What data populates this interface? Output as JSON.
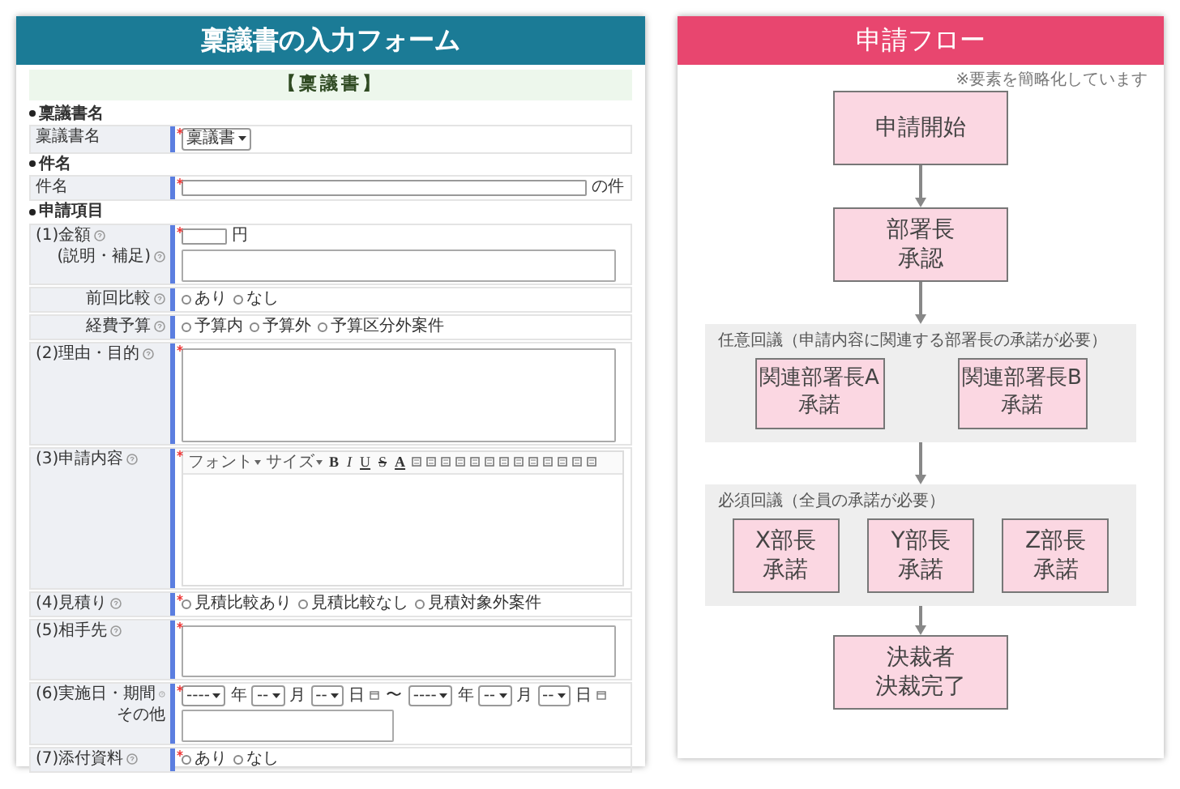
{
  "form_panel": {
    "title": "稟議書の入力フォーム",
    "heading": "【稟議書】",
    "sections": [
      {
        "title": "稟議書名",
        "rows": [
          {
            "kind": "select",
            "label": "稟議書名",
            "help": false,
            "required": true,
            "value": "稟議書"
          }
        ]
      },
      {
        "title": "件名",
        "rows": [
          {
            "kind": "text",
            "label": "件名",
            "help": false,
            "required": true,
            "suffix": "の件"
          }
        ]
      },
      {
        "title": "申請項目",
        "rows": [
          {
            "kind": "amount",
            "label": "(1)金額",
            "sub": false,
            "help": true,
            "required": true,
            "suffix": "円",
            "note_label": "(説明・補足)",
            "note_help": true
          },
          {
            "kind": "radio",
            "label": "前回比較",
            "sub": true,
            "help": true,
            "required": false,
            "options": [
              {
                "label": "あり",
                "selected": false
              },
              {
                "label": "なし",
                "selected": false
              }
            ]
          },
          {
            "kind": "radio",
            "label": "経費予算",
            "sub": true,
            "help": true,
            "required": false,
            "options": [
              {
                "label": "予算内",
                "selected": false
              },
              {
                "label": "予算外",
                "selected": false
              },
              {
                "label": "予算区分外案件",
                "selected": false
              }
            ]
          },
          {
            "kind": "long_text",
            "label": "(2)理由・目的",
            "sub": false,
            "help": true,
            "required": true
          },
          {
            "kind": "rich_text",
            "label": "(3)申請内容",
            "sub": false,
            "help": true,
            "required": true,
            "toolbar": [
              {
                "kind": "select",
                "label": "フォント"
              },
              {
                "kind": "select",
                "label": "サイズ"
              },
              {
                "kind": "glyph",
                "label": "B"
              },
              {
                "kind": "glyph",
                "label": "I"
              },
              {
                "kind": "glyph",
                "label": "U"
              },
              {
                "kind": "glyph",
                "label": "S"
              },
              {
                "kind": "glyph",
                "label": "A"
              },
              {
                "kind": "icon"
              },
              {
                "kind": "icon"
              },
              {
                "kind": "icon"
              },
              {
                "kind": "icon"
              },
              {
                "kind": "icon"
              },
              {
                "kind": "icon"
              },
              {
                "kind": "icon"
              },
              {
                "kind": "icon"
              },
              {
                "kind": "icon"
              },
              {
                "kind": "icon"
              },
              {
                "kind": "icon"
              },
              {
                "kind": "icon"
              },
              {
                "kind": "icon"
              }
            ]
          },
          {
            "kind": "radio",
            "label": "(4)見積り",
            "sub": false,
            "help": true,
            "required": true,
            "options": [
              {
                "label": "見積比較あり",
                "selected": false
              },
              {
                "label": "見積比較なし",
                "selected": false
              },
              {
                "label": "見積対象外案件",
                "selected": false
              }
            ]
          },
          {
            "kind": "text_area",
            "label": "(5)相手先",
            "sub": false,
            "help": true,
            "required": true
          },
          {
            "kind": "period",
            "label": "(6)実施日・期間",
            "sub": false,
            "help": true,
            "required": true,
            "start": {
              "year_value": "----",
              "month_value": "--",
              "day_value": "--",
              "year": "年",
              "month": "月",
              "day": "日"
            },
            "separator": "〜",
            "end": {
              "year_value": "----",
              "month_value": "--",
              "day_value": "--",
              "year": "年",
              "month": "月",
              "day": "日"
            },
            "other_label": "その他"
          },
          {
            "kind": "radio",
            "label": "(7)添付資料",
            "sub": false,
            "help": true,
            "required": true,
            "options": [
              {
                "label": "あり",
                "selected": false
              },
              {
                "label": "なし",
                "selected": false
              }
            ]
          }
        ]
      }
    ]
  },
  "flow_panel": {
    "title": "申請フロー",
    "note": "※要素を簡略化しています",
    "steps": [
      {
        "kind": "box",
        "lines": [
          "申請開始"
        ]
      },
      {
        "kind": "box",
        "lines": [
          "部署長",
          "承認"
        ]
      },
      {
        "kind": "group",
        "title": "任意回議（申請内容に関連する部署長の承諾が必要）",
        "boxes": [
          [
            "関連部署長A",
            "承諾"
          ],
          [
            "関連部署長B",
            "承諾"
          ]
        ]
      },
      {
        "kind": "group",
        "title": "必須回議（全員の承諾が必要）",
        "boxes": [
          [
            "X部長",
            "承諾"
          ],
          [
            "Y部長",
            "承諾"
          ],
          [
            "Z部長",
            "承諾"
          ]
        ]
      },
      {
        "kind": "box",
        "lines": [
          "決裁者",
          "決裁完了"
        ]
      }
    ]
  }
}
